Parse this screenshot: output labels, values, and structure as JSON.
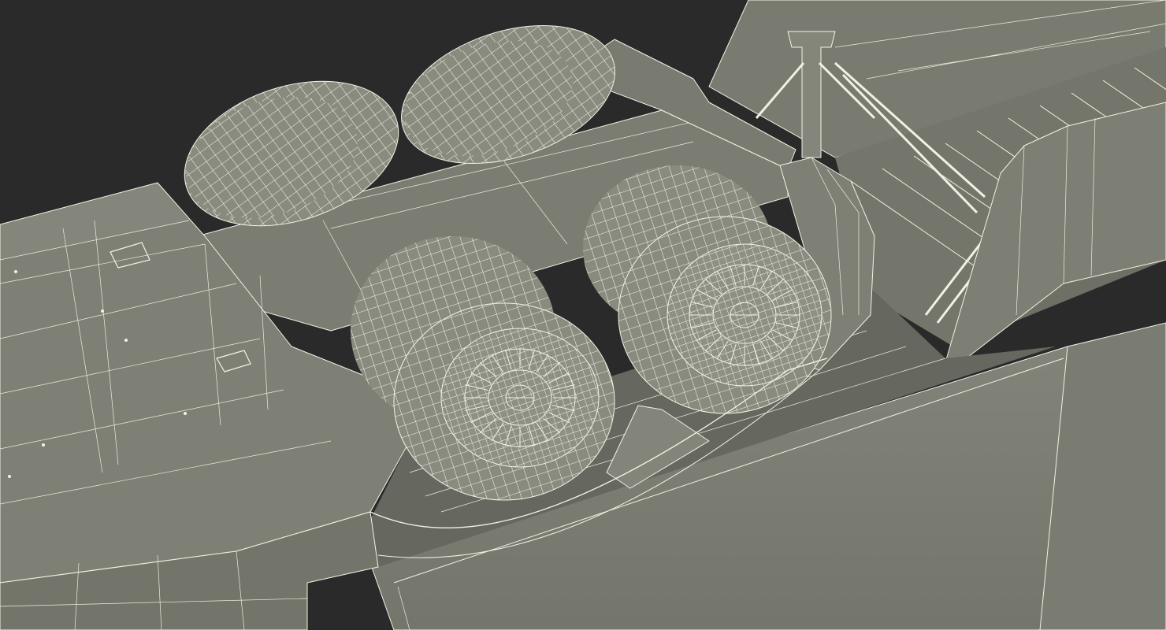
{
  "scene": {
    "background_color": "#2a2a2a",
    "surface_color": "#7d7e72",
    "surface_shadow_color": "#5e5f55",
    "tire_color": "#8a8b7f",
    "wireframe_color": "#f2f2e6",
    "wheel_count": 4
  }
}
